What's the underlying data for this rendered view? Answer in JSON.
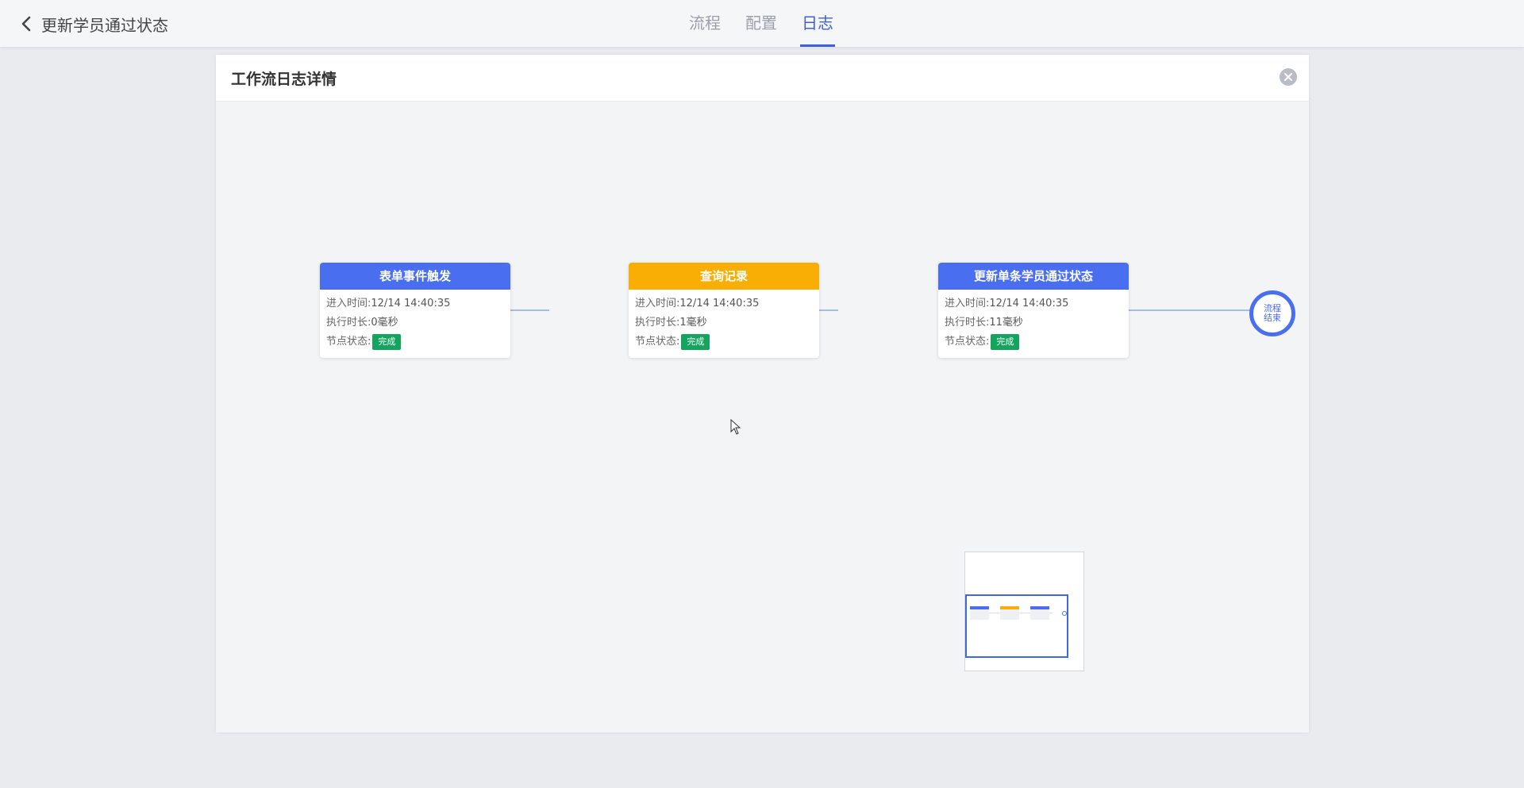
{
  "header": {
    "back_title": "更新学员通过状态",
    "tabs": [
      {
        "label": "流程",
        "active": false
      },
      {
        "label": "配置",
        "active": false
      },
      {
        "label": "日志",
        "active": true
      }
    ]
  },
  "panel": {
    "title": "工作流日志详情",
    "nodes": [
      {
        "title": "表单事件触发",
        "header_color": "#4a6ef0",
        "enter_label": "进入时间:",
        "enter_value": "12/14 14:40:35",
        "duration_label": "执行时长:",
        "duration_value": "0毫秒",
        "status_label": "节点状态:",
        "status_value": "完成"
      },
      {
        "title": "查询记录",
        "header_color": "#f8ae05",
        "enter_label": "进入时间:",
        "enter_value": "12/14 14:40:35",
        "duration_label": "执行时长:",
        "duration_value": "1毫秒",
        "status_label": "节点状态:",
        "status_value": "完成"
      },
      {
        "title": "更新单条学员通过状态",
        "header_color": "#4a6ef0",
        "enter_label": "进入时间:",
        "enter_value": "12/14 14:40:35",
        "duration_label": "执行时长:",
        "duration_value": "11毫秒",
        "status_label": "节点状态:",
        "status_value": "完成"
      }
    ],
    "end_node": {
      "line1": "流程",
      "line2": "结束"
    }
  },
  "colors": {
    "accent": "#3f5fe0",
    "status_done": "#13a45e",
    "node_blue": "#4a6ef0",
    "node_orange": "#f8ae05"
  },
  "icons": {
    "back": "chevron-left-icon",
    "close": "close-circle-icon"
  }
}
